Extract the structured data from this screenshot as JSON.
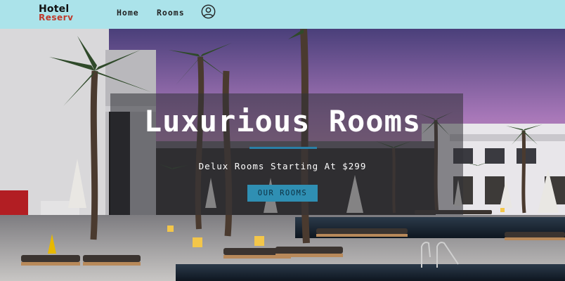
{
  "header": {
    "logo_line1": "Hotel",
    "logo_line2": "Reserv",
    "nav": {
      "home": "Home",
      "rooms": "Rooms"
    },
    "account_icon": "user-circle-icon"
  },
  "hero": {
    "title": "Luxurious Rooms",
    "subtitle": "Delux Rooms Starting At $299",
    "cta_label": "OUR ROOMS"
  },
  "colors": {
    "header_bg": "#abe3ea",
    "logo_accent": "#c0392b",
    "underline": "#2a7fa6",
    "button_bg": "#2f8fb3"
  }
}
